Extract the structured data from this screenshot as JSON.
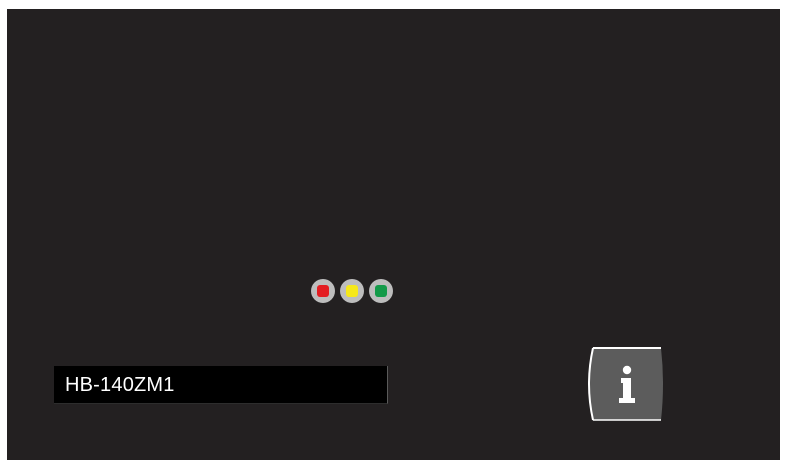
{
  "device": {
    "name": "HB-140ZM1"
  },
  "status_lights": [
    {
      "name": "red",
      "color": "#e41d22"
    },
    {
      "name": "yellow",
      "color": "#f6e81a"
    },
    {
      "name": "green",
      "color": "#139a49"
    }
  ],
  "info_button": {
    "icon": "info-icon",
    "background": "#5c5c5c",
    "border": "#ffffff"
  },
  "colors": {
    "background": "#232021"
  }
}
